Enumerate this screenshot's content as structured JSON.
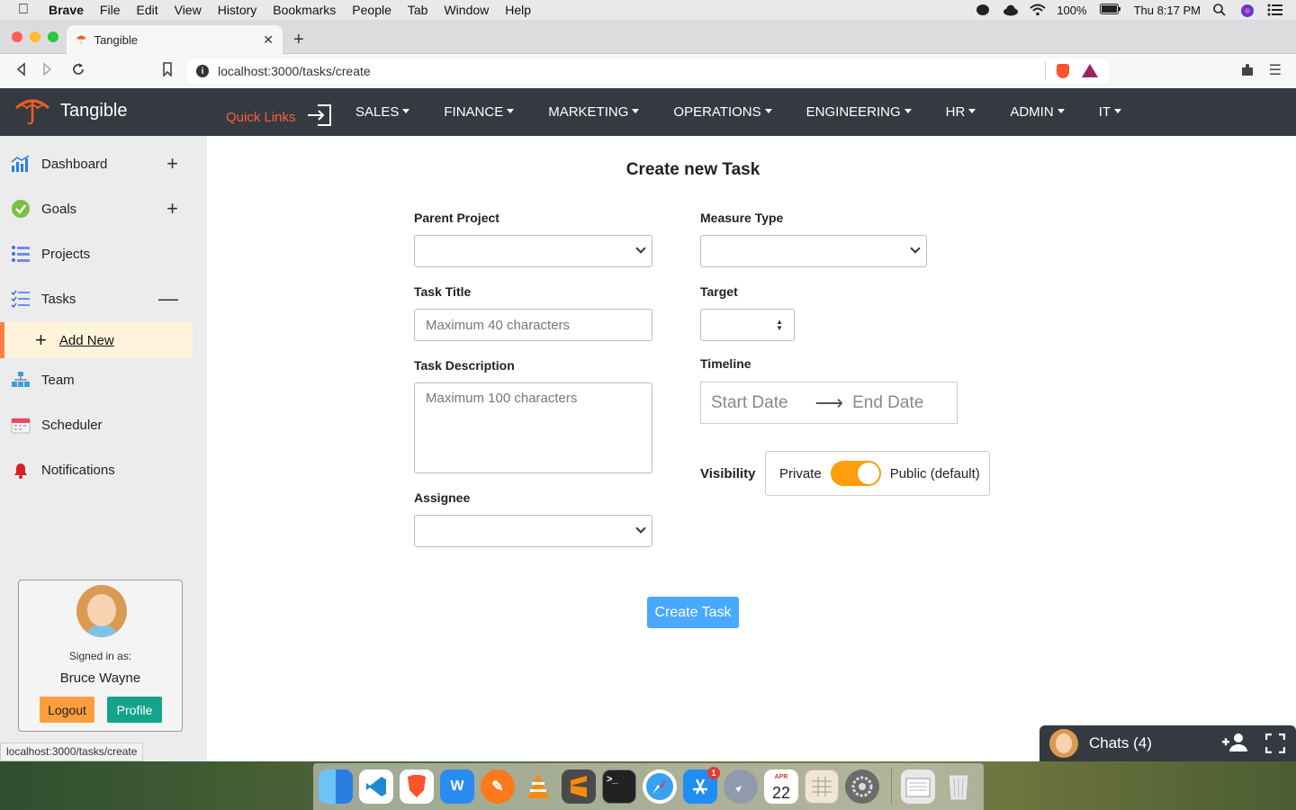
{
  "menubar": {
    "app": "Brave",
    "items": [
      "File",
      "Edit",
      "View",
      "History",
      "Bookmarks",
      "People",
      "Tab",
      "Window",
      "Help"
    ],
    "battery": "100%",
    "clock": "Thu 8:17 PM"
  },
  "browser": {
    "tab_title": "Tangible",
    "url": "localhost:3000/tasks/create",
    "status_url": "localhost:3000/tasks/create"
  },
  "appnav": {
    "brand": "Tangible",
    "quick_links": "Quick Links",
    "menus": [
      "SALES",
      "FINANCE",
      "MARKETING",
      "OPERATIONS",
      "ENGINEERING",
      "HR",
      "ADMIN",
      "IT"
    ]
  },
  "sidebar": {
    "items": [
      {
        "label": "Dashboard",
        "icon": "dashboard-icon",
        "action": "+"
      },
      {
        "label": "Goals",
        "icon": "goals-icon",
        "action": "+"
      },
      {
        "label": "Projects",
        "icon": "projects-icon",
        "action": ""
      },
      {
        "label": "Tasks",
        "icon": "tasks-icon",
        "action": "—"
      },
      {
        "label": "Team",
        "icon": "team-icon",
        "action": ""
      },
      {
        "label": "Scheduler",
        "icon": "calendar-icon",
        "action": ""
      },
      {
        "label": "Notifications",
        "icon": "bell-icon",
        "action": ""
      }
    ],
    "subitem": "Add New",
    "user": {
      "signed_in_label": "Signed in as:",
      "name": "Bruce Wayne",
      "logout": "Logout",
      "profile": "Profile"
    }
  },
  "form": {
    "title": "Create new Task",
    "parent_project_label": "Parent Project",
    "task_title_label": "Task Title",
    "task_title_placeholder": "Maximum 40 characters",
    "task_description_label": "Task Description",
    "task_description_placeholder": "Maximum 100 characters",
    "assignee_label": "Assignee",
    "measure_type_label": "Measure Type",
    "target_label": "Target",
    "timeline_label": "Timeline",
    "start_date_placeholder": "Start Date",
    "end_date_placeholder": "End Date",
    "visibility_label": "Visibility",
    "private_label": "Private",
    "public_label": "Public (default)",
    "submit": "Create Task"
  },
  "chat": {
    "label": "Chats (4)"
  },
  "dock": {
    "calendar_month": "APR",
    "calendar_day": "22",
    "app_store_badge": "1"
  },
  "colors": {
    "navbar": "#343a40",
    "accent_orange": "#fd5e3c",
    "toggle": "#fd9e0c",
    "create_button": "#4aa8ff",
    "profile_button": "#14a38b"
  }
}
